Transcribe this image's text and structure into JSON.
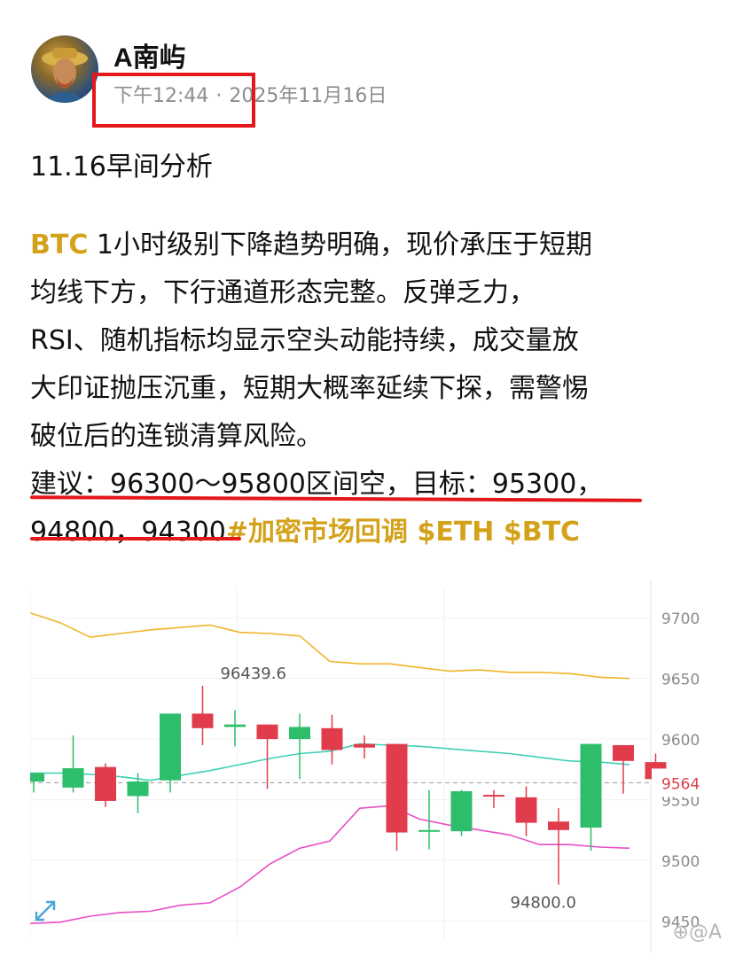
{
  "post": {
    "author": "A南屿",
    "time": "下午12:44",
    "dot": "·",
    "date": "2025年11月16日",
    "title": "11.16早间分析",
    "body_tag": "BTC",
    "body_lines": [
      " 1小时级别下降趋势明确，现价承压于短期",
      "均线下方，下行通道形态完整。反弹乏力，",
      "RSI、随机指标均显示空头动能持续，成交量放",
      "大印证抛压沉重，短期大概率延续下探，需警惕",
      "破位后的连锁清算风险。"
    ],
    "advice_line1": "建议：96300～95800区间空，目标：95300，",
    "advice_line2": "94800，94300",
    "hashtags": "#加密市场回调 $ETH $BTC"
  },
  "colors": {
    "accent_gold": "#d4a21a",
    "annotation_red": "#e4181c",
    "candle_up": "#2ebd6b",
    "candle_down": "#e03c4c",
    "upper_band": "#f0b429",
    "mid_band": "#3fd0b5",
    "lower_band": "#e84fc6",
    "price_tag": "#e03c4c"
  },
  "watermark": "⊕@A",
  "icons": {
    "expand": "expand-icon",
    "watermark": "watermark-icon"
  },
  "chart_data": {
    "type": "candlestick",
    "y_ticks": [
      "9700",
      "9650",
      "9600",
      "9550",
      "9500",
      "9450"
    ],
    "y_tick_values": [
      97000,
      96500,
      96000,
      95500,
      95000,
      94500
    ],
    "ylim": [
      94350,
      97250
    ],
    "current_price_label": "9564",
    "current_price": 95640,
    "annotations": [
      {
        "text": "96439.6",
        "value": 96439.6,
        "candle_index": 5
      },
      {
        "text": "94800.0",
        "value": 94800.0,
        "candle_index": 15
      }
    ],
    "candles": [
      {
        "o": 95650,
        "c": 95720,
        "h": 95700,
        "l": 95560
      },
      {
        "o": 95600,
        "c": 95760,
        "h": 96030,
        "l": 95560
      },
      {
        "o": 95770,
        "c": 95490,
        "h": 95800,
        "l": 95440
      },
      {
        "o": 95530,
        "c": 95650,
        "h": 95720,
        "l": 95390
      },
      {
        "o": 95660,
        "c": 96210,
        "h": 96210,
        "l": 95560
      },
      {
        "o": 96210,
        "c": 96090,
        "h": 96439.6,
        "l": 95950
      },
      {
        "o": 96100,
        "c": 96120,
        "h": 96240,
        "l": 95940
      },
      {
        "o": 96120,
        "c": 96000,
        "h": 96120,
        "l": 95590
      },
      {
        "o": 96000,
        "c": 96100,
        "h": 96210,
        "l": 95670
      },
      {
        "o": 96090,
        "c": 95910,
        "h": 96200,
        "l": 95790
      },
      {
        "o": 95960,
        "c": 95930,
        "h": 96030,
        "l": 95840
      },
      {
        "o": 95960,
        "c": 95230,
        "h": 95960,
        "l": 95080
      },
      {
        "o": 95240,
        "c": 95250,
        "h": 95580,
        "l": 95090
      },
      {
        "o": 95240,
        "c": 95570,
        "h": 95580,
        "l": 95200
      },
      {
        "o": 95540,
        "c": 95530,
        "h": 95580,
        "l": 95430
      },
      {
        "o": 95520,
        "c": 95310,
        "h": 95610,
        "l": 95200
      },
      {
        "o": 95320,
        "c": 95250,
        "h": 95430,
        "l": 94800.0
      },
      {
        "o": 95270,
        "c": 95960,
        "h": 95960,
        "l": 95080
      },
      {
        "o": 95950,
        "c": 95820,
        "h": 95950,
        "l": 95550
      },
      {
        "o": 95810,
        "c": 95670,
        "h": 95880,
        "l": 95640
      }
    ],
    "upper_band": [
      97040,
      96960,
      96840,
      96870,
      96900,
      96920,
      96940,
      96880,
      96870,
      96850,
      96640,
      96620,
      96620,
      96590,
      96560,
      96570,
      96550,
      96550,
      96540,
      96510,
      96500
    ],
    "mid_band": [
      95720,
      95720,
      95710,
      95690,
      95660,
      95700,
      95740,
      95790,
      95840,
      95880,
      95900,
      95960,
      95950,
      95940,
      95920,
      95900,
      95880,
      95850,
      95820,
      95810,
      95790
    ],
    "lower_band": [
      94480,
      94490,
      94540,
      94570,
      94580,
      94630,
      94650,
      94780,
      94970,
      95100,
      95160,
      95430,
      95450,
      95340,
      95290,
      95250,
      95210,
      95130,
      95130,
      95110,
      95100
    ]
  }
}
